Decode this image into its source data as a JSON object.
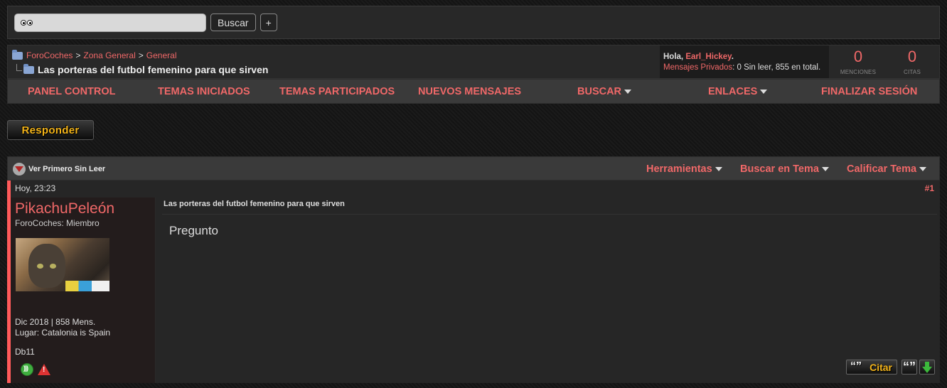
{
  "search": {
    "button_label": "Buscar",
    "plus_label": "+"
  },
  "breadcrumb": {
    "items": [
      "ForoCoches",
      "Zona General",
      "General"
    ],
    "separator": ">"
  },
  "thread": {
    "title": "Las porteras del futbol femenino para que sirven"
  },
  "user": {
    "greeting": "Hola, ",
    "name": "Earl_Hickey",
    "greeting_end": ".",
    "pm_label": "Mensajes Privados",
    "pm_text": ": 0 Sin leer, 855 en total."
  },
  "counters": [
    {
      "value": "0",
      "label": "MENCIONES"
    },
    {
      "value": "0",
      "label": "CITAS"
    }
  ],
  "nav": {
    "items": [
      {
        "label": "PANEL CONTROL",
        "has_caret": false
      },
      {
        "label": "TEMAS INICIADOS",
        "has_caret": false
      },
      {
        "label": "TEMAS PARTICIPADOS",
        "has_caret": false
      },
      {
        "label": "NUEVOS MENSAJES",
        "has_caret": false
      },
      {
        "label": "BUSCAR",
        "has_caret": true
      },
      {
        "label": "ENLACES",
        "has_caret": true
      },
      {
        "label": "FINALIZAR SESIÓN",
        "has_caret": false
      }
    ]
  },
  "reply_button": "Responder",
  "threadbar": {
    "ver_primero": "Ver Primero Sin Leer",
    "tools": [
      {
        "label": "Herramientas"
      },
      {
        "label": "Buscar en Tema"
      },
      {
        "label": "Calificar Tema"
      }
    ]
  },
  "post": {
    "date": "Hoy, 23:23",
    "number": "#1",
    "author": "PikachuPeleón",
    "author_title": "ForoCoches: Miembro",
    "join_info": "Dic 2018 | 858 Mens.",
    "location": "Lugar: Catalonia is Spain",
    "extra": "Db11",
    "title": "Las porteras del futbol femenino para que sirven",
    "body": "Pregunto",
    "citar_label": "Citar",
    "quote_glyph": "“”"
  },
  "colors": {
    "accent": "#f06868",
    "background": "#141414",
    "bar": "#3a3a3a",
    "post_border": "#ff5a5a",
    "button_text": "#f5b51a"
  },
  "icons": [
    "eyes-icon",
    "folder-icon",
    "ver-primero-icon",
    "online-icon",
    "report-icon",
    "down-arrow-icon"
  ]
}
